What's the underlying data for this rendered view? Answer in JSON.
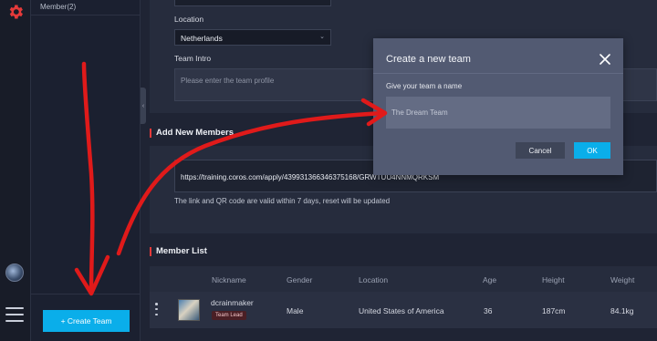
{
  "sidebar": {
    "member_count": "Member(2)",
    "create_team_label": "+ Create Team",
    "collapse_glyph": "‹"
  },
  "form": {
    "location_label": "Location",
    "location_value": "Netherlands",
    "team_intro_label": "Team Intro",
    "team_intro_placeholder": "Please enter the team profile"
  },
  "add_members": {
    "title": "Add New Members",
    "invite_link": "https://training.coros.com/apply/439931366346375168/GRWTUU4NNMQRKSM",
    "note": "The link and QR code are valid within 7 days, reset will be updated"
  },
  "member_list": {
    "title": "Member List",
    "headers": [
      "Nickname",
      "Gender",
      "Location",
      "Age",
      "Height",
      "Weight"
    ],
    "rows": [
      {
        "nickname": "dcrainmaker",
        "badge": "Team Lead",
        "gender": "Male",
        "location": "United States of America",
        "age": "36",
        "height": "187cm",
        "weight": "84.1kg"
      }
    ]
  },
  "modal": {
    "title": "Create a new team",
    "field_label": "Give your team a name",
    "field_value": "The Dream Team",
    "cancel_label": "Cancel",
    "ok_label": "OK"
  },
  "colors": {
    "accent": "#0aaeea",
    "brand_red": "#e53a3a",
    "annotation_red": "#e01a1a"
  },
  "icons": [
    "gear-icon",
    "avatar",
    "hamburger-menu-icon",
    "chevron-down-icon",
    "close-icon",
    "kebab-menu-icon"
  ]
}
